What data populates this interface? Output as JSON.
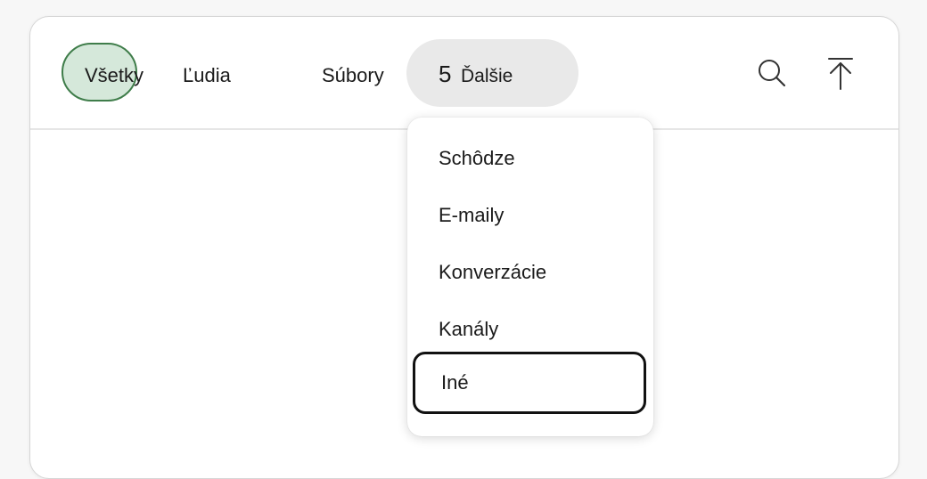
{
  "tabs": {
    "all_label": "Všetky",
    "people_label": "Ľudia",
    "files_label": "Súbory",
    "more_count": "5",
    "more_label": "Ďalšie"
  },
  "icons": {
    "search": "search-icon",
    "scroll_top": "arrow-up-to-line-icon"
  },
  "dropdown": {
    "items": [
      "Schôdze",
      "E-maily",
      "Konverzácie",
      "Kanály",
      "Iné"
    ],
    "focused_item": "Iné"
  },
  "colors": {
    "selected_tab_fill": "#d5e8da",
    "selected_tab_border": "#3f7d4a",
    "more_pill": "#e9e9e9",
    "focus_ring": "#111111"
  }
}
